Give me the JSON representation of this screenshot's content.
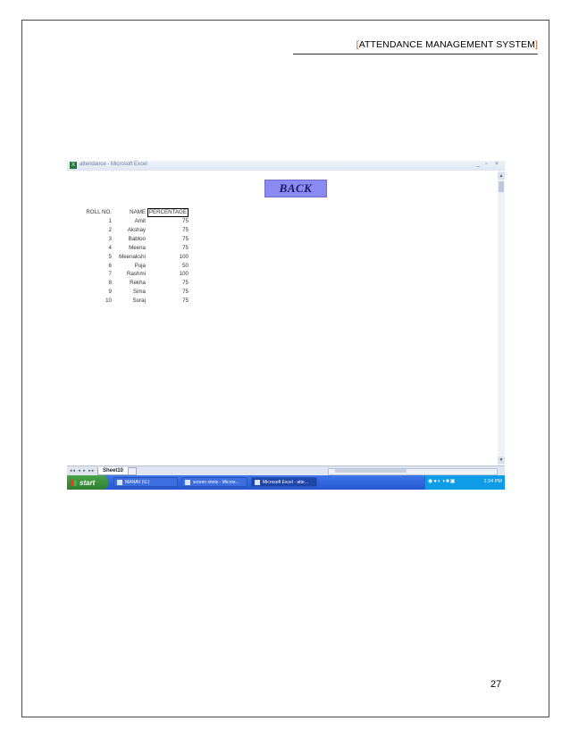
{
  "document": {
    "header_title": "ATTENDANCE MANAGEMENT SYSTEM",
    "bracket_open": "[",
    "bracket_close": "]",
    "page_number": "27"
  },
  "window": {
    "title": "attendance - Microsoft Excel",
    "app_icon_label": "X",
    "controls": {
      "minimize": "_",
      "maximize": "▫",
      "close": "×"
    }
  },
  "sheet": {
    "back_button_label": "BACK",
    "headers": {
      "roll": "ROLL NO.",
      "name": "NAME",
      "percentage": "PERCENTAGE"
    },
    "rows": [
      {
        "roll": "1",
        "name": "Amit",
        "pct": "75"
      },
      {
        "roll": "2",
        "name": "Akshay",
        "pct": "75"
      },
      {
        "roll": "3",
        "name": "Babloo",
        "pct": "75"
      },
      {
        "roll": "4",
        "name": "Meena",
        "pct": "75"
      },
      {
        "roll": "5",
        "name": "Meenakshi",
        "pct": "100"
      },
      {
        "roll": "6",
        "name": "Puja",
        "pct": "50"
      },
      {
        "roll": "7",
        "name": "Rashmi",
        "pct": "100"
      },
      {
        "roll": "8",
        "name": "Rekha",
        "pct": "75"
      },
      {
        "roll": "9",
        "name": "Sima",
        "pct": "75"
      },
      {
        "roll": "10",
        "name": "Suraj",
        "pct": "75"
      }
    ]
  },
  "tabs": {
    "nav_glyphs": "◂◂ ◂ ▸ ▸▸",
    "active_sheet": "Sheet10"
  },
  "taskbar": {
    "start_label": "start",
    "items": [
      {
        "label": "MANAV (G:)"
      },
      {
        "label": "screen shots - Micros..."
      },
      {
        "label": "Microsoft Excel - atte..."
      }
    ],
    "tray_icons": "◉●◐◑■▣",
    "clock": "1:24 PM"
  },
  "colors": {
    "back_button": "#8a8af2",
    "taskbar": "#2457d0",
    "start_button": "#2f7f2f",
    "bracket": "#c05a1a"
  }
}
